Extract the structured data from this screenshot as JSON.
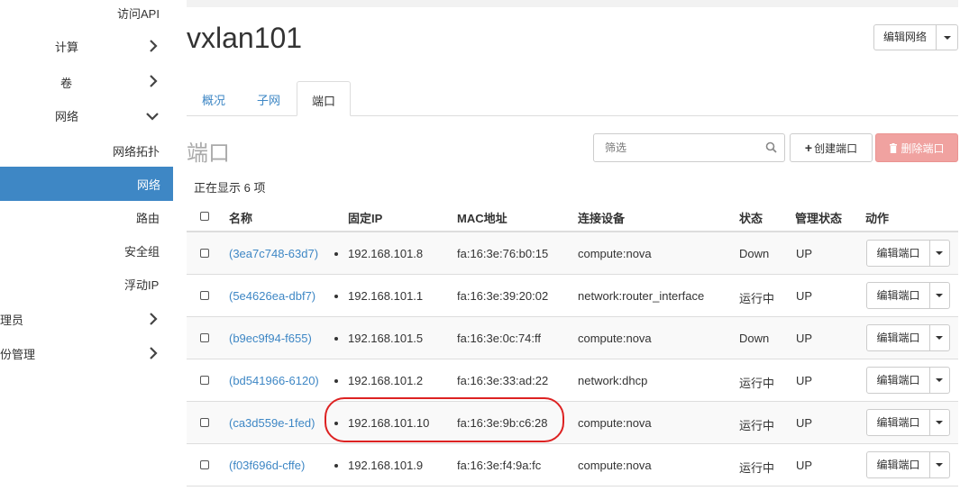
{
  "sidebar": {
    "api_access": "访问API",
    "compute": "计算",
    "volumes": "卷",
    "network": "网络",
    "network_topology": "网络拓扑",
    "networks": "网络",
    "routers": "路由",
    "security_groups": "安全组",
    "floating_ips": "浮动IP",
    "admin": "理员",
    "identity": "份管理"
  },
  "header": {
    "title": "vxlan101",
    "edit_network_label": "编辑网络"
  },
  "tabs": [
    {
      "label": "概况"
    },
    {
      "label": "子网"
    },
    {
      "label": "端口"
    }
  ],
  "ports": {
    "title": "端口",
    "filter_placeholder": "筛选",
    "create_label": "创建端口",
    "delete_label": "删除端口",
    "count_text": "正在显示 6 项",
    "columns": {
      "name": "名称",
      "fixed_ip": "固定IP",
      "mac": "MAC地址",
      "device": "连接设备",
      "status": "状态",
      "admin_state": "管理状态",
      "actions": "动作"
    },
    "rows": [
      {
        "name": "(3ea7c748-63d7)",
        "ip": "192.168.101.8",
        "mac": "fa:16:3e:76:b0:15",
        "device": "compute:nova",
        "status": "Down",
        "admin_state": "UP",
        "action": "编辑端口"
      },
      {
        "name": "(5e4626ea-dbf7)",
        "ip": "192.168.101.1",
        "mac": "fa:16:3e:39:20:02",
        "device": "network:router_interface",
        "status": "运行中",
        "admin_state": "UP",
        "action": "编辑端口"
      },
      {
        "name": "(b9ec9f94-f655)",
        "ip": "192.168.101.5",
        "mac": "fa:16:3e:0c:74:ff",
        "device": "compute:nova",
        "status": "Down",
        "admin_state": "UP",
        "action": "编辑端口"
      },
      {
        "name": "(bd541966-6120)",
        "ip": "192.168.101.2",
        "mac": "fa:16:3e:33:ad:22",
        "device": "network:dhcp",
        "status": "运行中",
        "admin_state": "UP",
        "action": "编辑端口"
      },
      {
        "name": "(ca3d559e-1fed)",
        "ip": "192.168.101.10",
        "mac": "fa:16:3e:9b:c6:28",
        "device": "compute:nova",
        "status": "运行中",
        "admin_state": "UP",
        "action": "编辑端口"
      },
      {
        "name": "(f03f696d-cffe)",
        "ip": "192.168.101.9",
        "mac": "fa:16:3e:f4:9a:fc",
        "device": "compute:nova",
        "status": "运行中",
        "admin_state": "UP",
        "action": "编辑端口"
      }
    ]
  },
  "colors": {
    "accent": "#3e87c5",
    "danger": "#f0a2a0",
    "highlight": "#dd2222"
  }
}
